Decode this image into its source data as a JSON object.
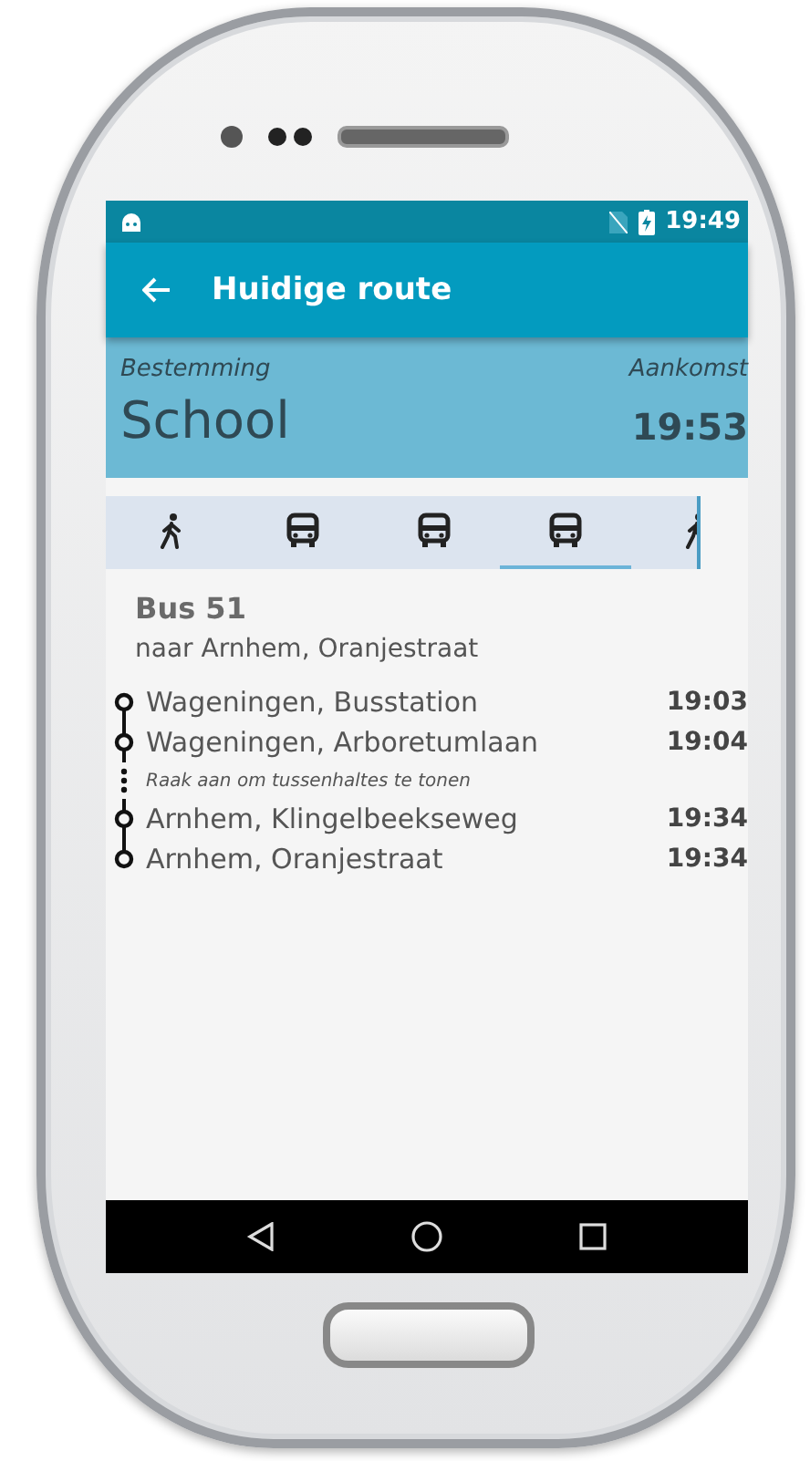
{
  "status_bar": {
    "time": "19:49"
  },
  "app_bar": {
    "title": "Huidige route"
  },
  "destination": {
    "label": "Bestemming",
    "value": "School",
    "arrival_label": "Aankomst",
    "arrival_time": "19:53"
  },
  "legs": [
    {
      "kind": "walk",
      "selected": false
    },
    {
      "kind": "bus",
      "selected": false
    },
    {
      "kind": "bus",
      "selected": false
    },
    {
      "kind": "bus",
      "selected": true
    },
    {
      "kind": "walk",
      "selected": false
    }
  ],
  "leg_detail": {
    "title": "Bus 51",
    "direction": "naar Arnhem, Oranjestraat"
  },
  "stops": [
    {
      "kind": "stop",
      "name": "Wageningen, Busstation",
      "time": "19:03"
    },
    {
      "kind": "stop",
      "name": "Wageningen, Arboretumlaan",
      "time": "19:04"
    },
    {
      "kind": "hint",
      "text": "Raak aan om tussenhaltes te tonen"
    },
    {
      "kind": "stop",
      "name": "Arnhem, Klingelbeekseweg",
      "time": "19:34"
    },
    {
      "kind": "stop",
      "name": "Arnhem, Oranjestraat",
      "time": "19:34"
    }
  ]
}
